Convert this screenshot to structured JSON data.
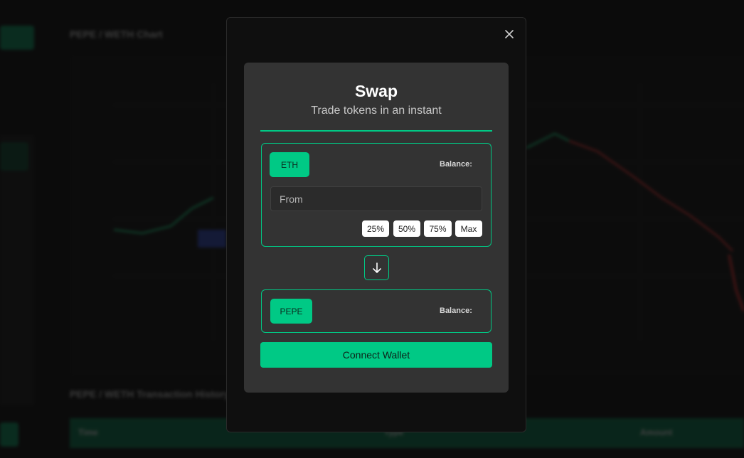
{
  "background": {
    "chart_title": "PEPE / WETH Chart",
    "history_title": "PEPE / WETH Transaction History",
    "table_headers": [
      "Time",
      "Type",
      "Amount"
    ]
  },
  "modal": {
    "close_icon": "close-icon",
    "title": "Swap",
    "subtitle": "Trade tokens in an instant",
    "from": {
      "token_label": "ETH",
      "balance_label": "Balance:",
      "input_placeholder": "From",
      "percent_buttons": [
        "25%",
        "50%",
        "75%",
        "Max"
      ]
    },
    "swap_direction_icon": "arrow-down-icon",
    "to": {
      "token_label": "PEPE",
      "balance_label": "Balance:"
    },
    "connect_label": "Connect Wallet"
  },
  "colors": {
    "accent": "#00c985",
    "card": "#333333",
    "modal": "#0f0f0f"
  }
}
